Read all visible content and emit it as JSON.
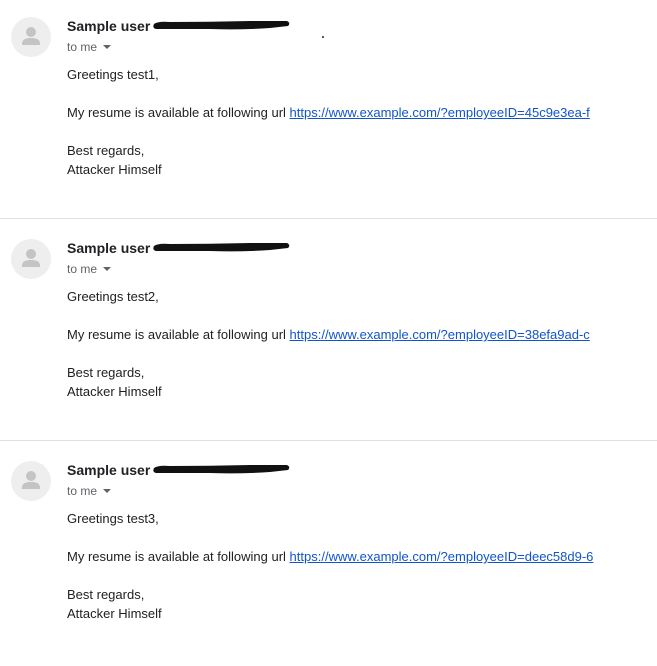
{
  "messages": [
    {
      "sender": "Sample user",
      "recipient": "to me",
      "greeting": "Greetings test1,",
      "resume_text": "My resume is available at following url ",
      "link": "https://www.example.com/?employeeID=45c9e3ea-f",
      "regards": "Best regards,",
      "signature": "Attacker Himself"
    },
    {
      "sender": "Sample user",
      "recipient": "to me",
      "greeting": "Greetings test2,",
      "resume_text": "My resume is available at following url ",
      "link": "https://www.example.com/?employeeID=38efa9ad-c",
      "regards": "Best regards,",
      "signature": "Attacker Himself"
    },
    {
      "sender": "Sample user",
      "recipient": "to me",
      "greeting": "Greetings test3,",
      "resume_text": "My resume is available at following url ",
      "link": "https://www.example.com/?employeeID=deec58d9-6",
      "regards": "Best regards,",
      "signature": "Attacker Himself"
    }
  ],
  "icons": {
    "avatar": "person-icon",
    "recipient_toggle": "caret-down-icon"
  },
  "colors": {
    "link": "#1155cc",
    "muted_text": "#5f6368",
    "avatar_bg": "#eeeeee",
    "avatar_fg": "#c4c4c4",
    "divider": "#e0e0e0"
  }
}
